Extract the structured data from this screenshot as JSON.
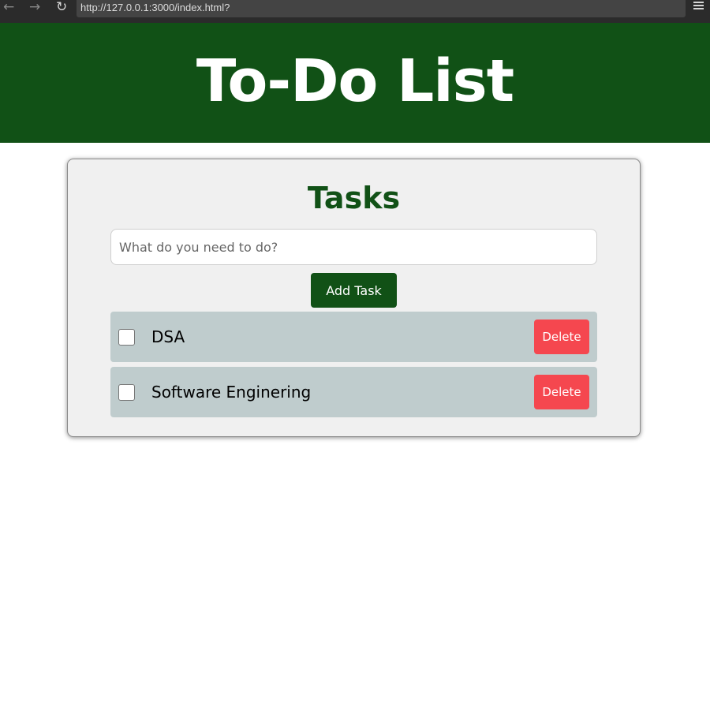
{
  "browser": {
    "back_icon": "←",
    "forward_icon": "→",
    "reload_icon": "↻",
    "url": "http://127.0.0.1:3000/index.html?"
  },
  "header": {
    "title": "To-Do List",
    "background": "#115116"
  },
  "card": {
    "title": "Tasks",
    "input_placeholder": "What do you need to do?",
    "input_value": "",
    "add_button_label": "Add Task"
  },
  "tasks": [
    {
      "label": "DSA",
      "checked": false,
      "delete_label": "Delete"
    },
    {
      "label": "Software Enginering",
      "checked": false,
      "delete_label": "Delete"
    }
  ],
  "colors": {
    "accent": "#115116",
    "delete": "#f5474f",
    "task_row": "#bfcccd",
    "card_bg": "#f0f0f0"
  }
}
